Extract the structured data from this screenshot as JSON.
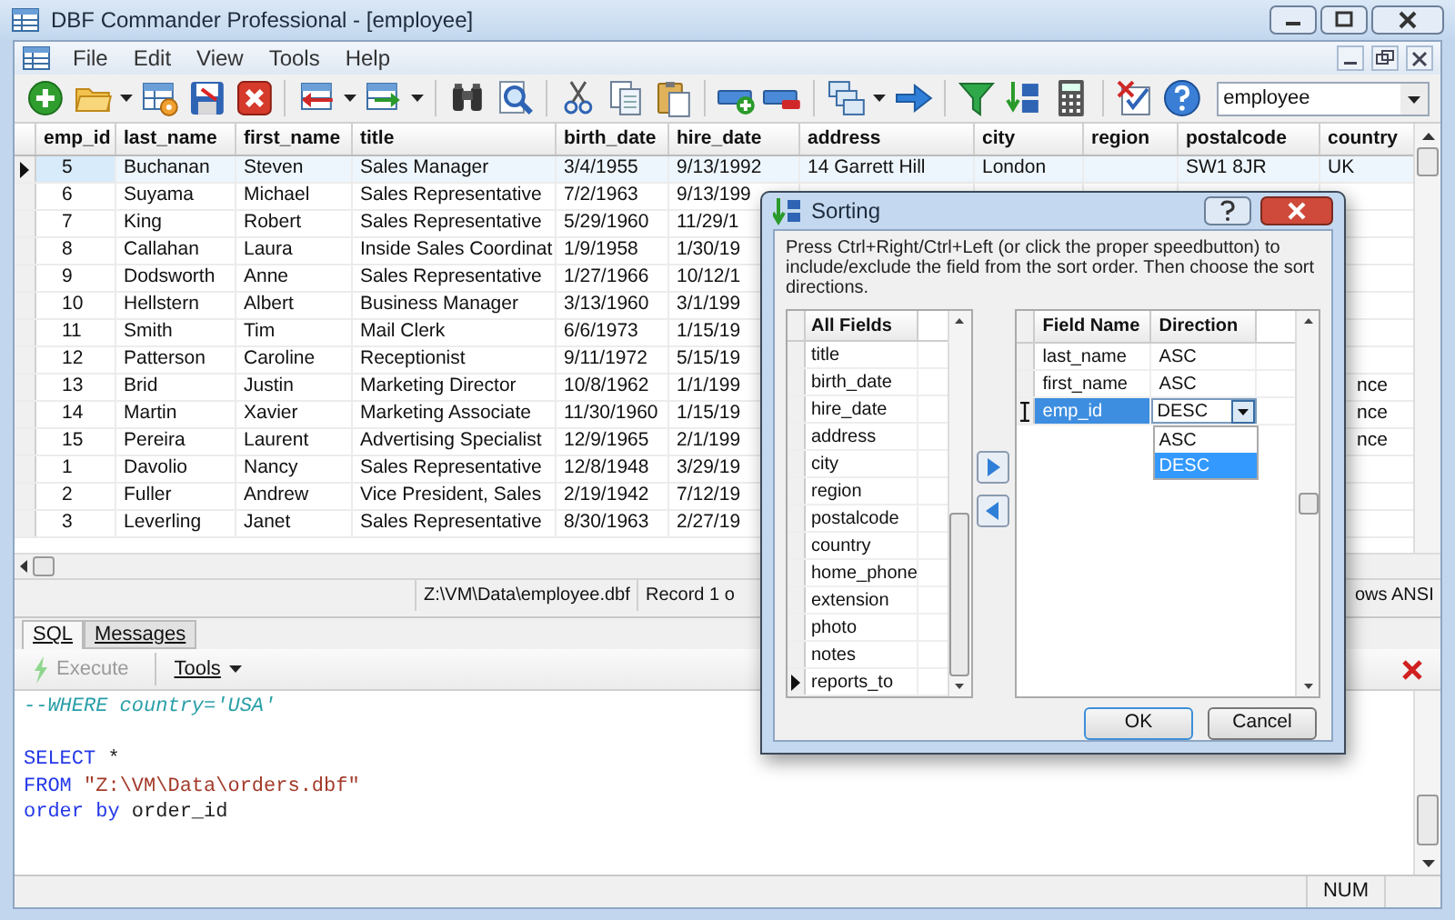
{
  "window": {
    "title": "DBF Commander Professional - [employee]"
  },
  "menu": [
    "File",
    "Edit",
    "View",
    "Tools",
    "Help"
  ],
  "toolbar": {
    "table_selector": "employee"
  },
  "table": {
    "columns": [
      "emp_id",
      "last_name",
      "first_name",
      "title",
      "birth_date",
      "hire_date",
      "address",
      "city",
      "region",
      "postalcode",
      "country"
    ],
    "rows": [
      {
        "current": true,
        "cells": [
          "5",
          "Buchanan",
          "Steven",
          "Sales Manager",
          "3/4/1955",
          "9/13/1992",
          "14 Garrett Hill",
          "London",
          null,
          "SW1 8JR",
          "UK"
        ]
      },
      {
        "current": false,
        "cells": [
          "6",
          "Suyama",
          "Michael",
          "Sales Representative",
          "7/2/1963",
          "9/13/199",
          null,
          null,
          null,
          null,
          null
        ]
      },
      {
        "current": false,
        "cells": [
          "7",
          "King",
          "Robert",
          "Sales Representative",
          "5/29/1960",
          "11/29/1",
          null,
          null,
          null,
          null,
          null
        ]
      },
      {
        "current": false,
        "cells": [
          "8",
          "Callahan",
          "Laura",
          "Inside Sales Coordinat",
          "1/9/1958",
          "1/30/19",
          null,
          null,
          null,
          null,
          null
        ]
      },
      {
        "current": false,
        "cells": [
          "9",
          "Dodsworth",
          "Anne",
          "Sales Representative",
          "1/27/1966",
          "10/12/1",
          null,
          null,
          null,
          null,
          null
        ]
      },
      {
        "current": false,
        "cells": [
          "10",
          "Hellstern",
          "Albert",
          "Business Manager",
          "3/13/1960",
          "3/1/199",
          null,
          null,
          null,
          null,
          null
        ]
      },
      {
        "current": false,
        "cells": [
          "11",
          "Smith",
          "Tim",
          "Mail Clerk",
          "6/6/1973",
          "1/15/19",
          null,
          null,
          null,
          null,
          null
        ]
      },
      {
        "current": false,
        "cells": [
          "12",
          "Patterson",
          "Caroline",
          "Receptionist",
          "9/11/1972",
          "5/15/19",
          null,
          null,
          null,
          null,
          null
        ]
      },
      {
        "current": false,
        "cells": [
          "13",
          "Brid",
          "Justin",
          "Marketing Director",
          "10/8/1962",
          "1/1/199",
          null,
          null,
          null,
          null,
          "nce"
        ]
      },
      {
        "current": false,
        "cells": [
          "14",
          "Martin",
          "Xavier",
          "Marketing Associate",
          "11/30/1960",
          "1/15/19",
          null,
          null,
          null,
          null,
          "nce"
        ]
      },
      {
        "current": false,
        "cells": [
          "15",
          "Pereira",
          "Laurent",
          "Advertising Specialist",
          "12/9/1965",
          "2/1/199",
          null,
          null,
          null,
          null,
          "nce"
        ]
      },
      {
        "current": false,
        "cells": [
          "1",
          "Davolio",
          "Nancy",
          "Sales Representative",
          "12/8/1948",
          "3/29/19",
          null,
          null,
          null,
          null,
          null
        ]
      },
      {
        "current": false,
        "cells": [
          "2",
          "Fuller",
          "Andrew",
          "Vice President, Sales",
          "2/19/1942",
          "7/12/19",
          null,
          null,
          null,
          null,
          null
        ]
      },
      {
        "current": false,
        "cells": [
          "3",
          "Leverling",
          "Janet",
          "Sales Representative",
          "8/30/1963",
          "2/27/19",
          null,
          null,
          null,
          null,
          null
        ]
      }
    ]
  },
  "status_bar": [
    "Z:\\VM\\Data\\employee.dbf",
    "Record 1 o",
    "ows ANSI"
  ],
  "sql_panel": {
    "tabs": [
      {
        "label": "SQL",
        "selected": true
      },
      {
        "label": "Messages",
        "selected": false
      }
    ],
    "execute": {
      "label": "Execute",
      "disabled": true
    },
    "tools": "Tools",
    "lines": [
      {
        "kind": "code",
        "tokens": [
          {
            "kind": "comment",
            "text": "--WHERE country='USA'"
          }
        ]
      },
      {
        "kind": "blank"
      },
      {
        "kind": "code",
        "tokens": [
          {
            "kind": "keyword",
            "text": "SELECT"
          },
          {
            "kind": "plain",
            "text": " *"
          }
        ]
      },
      {
        "kind": "code",
        "tokens": [
          {
            "kind": "keyword",
            "text": "FROM "
          },
          {
            "kind": "string",
            "text": "\"Z:\\VM\\Data\\orders.dbf\""
          }
        ]
      },
      {
        "kind": "code",
        "tokens": [
          {
            "kind": "keyword",
            "text": "order by "
          },
          {
            "kind": "plain",
            "text": "order_id"
          }
        ]
      }
    ]
  },
  "bottom_status": "NUM",
  "dialog": {
    "title": "Sorting",
    "instructions": "Press Ctrl+Right/Ctrl+Left (or click the proper speedbutton) to include/exclude the field from the sort order. Then choose the sort directions.",
    "all_fields": {
      "header": "All Fields",
      "items": [
        {
          "name": "title",
          "current": false
        },
        {
          "name": "birth_date",
          "current": false
        },
        {
          "name": "hire_date",
          "current": false
        },
        {
          "name": "address",
          "current": false
        },
        {
          "name": "city",
          "current": false
        },
        {
          "name": "region",
          "current": false
        },
        {
          "name": "postalcode",
          "current": false
        },
        {
          "name": "country",
          "current": false
        },
        {
          "name": "home_phone",
          "current": false
        },
        {
          "name": "extension",
          "current": false
        },
        {
          "name": "photo",
          "current": false
        },
        {
          "name": "notes",
          "current": false
        },
        {
          "name": "reports_to",
          "current": true
        }
      ]
    },
    "sort_fields": {
      "columns": [
        "Field Name",
        "Direction"
      ],
      "rows": [
        {
          "field": "last_name",
          "direction": "ASC",
          "selected": false
        },
        {
          "field": "first_name",
          "direction": "ASC",
          "selected": false
        },
        {
          "field": "emp_id",
          "direction": "DESC",
          "selected": true
        }
      ]
    },
    "direction_options": [
      {
        "label": "ASC",
        "selected": false
      },
      {
        "label": "DESC",
        "selected": true
      }
    ],
    "buttons": [
      "OK",
      "Cancel"
    ]
  }
}
